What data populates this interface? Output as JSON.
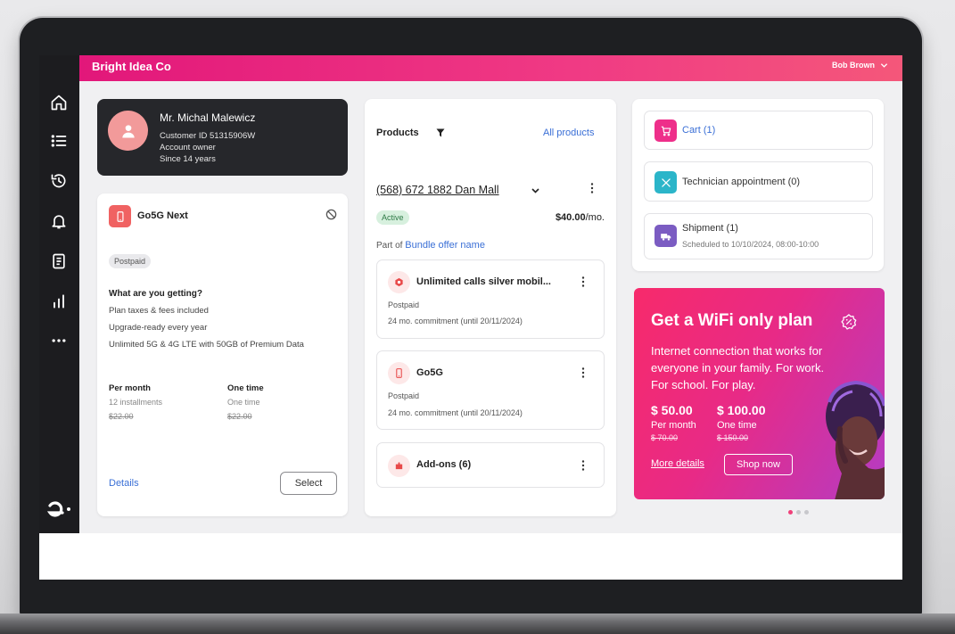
{
  "header": {
    "brand": "Bright Idea Co",
    "user": "Bob Brown",
    "user_menu_icon": "chevron-down-icon"
  },
  "sidebar": {
    "icons": [
      "home-icon",
      "list-icon",
      "history-icon",
      "bell-icon",
      "document-icon",
      "bar-chart-icon",
      "more-icon"
    ],
    "logo": "brand-logo"
  },
  "profile": {
    "name": "Mr. Michal Malewicz",
    "customer_id": "Customer ID 51315906W",
    "role": "Account owner",
    "since": "Since 14 years"
  },
  "plan": {
    "title": "Go5G Next",
    "type": "Postpaid",
    "getting_title": "What are you getting?",
    "features": [
      "Plan taxes & fees included",
      "Upgrade-ready every year",
      "Unlimited 5G & 4G LTE with 50GB of Premium Data"
    ],
    "per_month_label": "Per month",
    "per_month_sub": "12 installments",
    "per_month_price": "$22.00",
    "one_time_label": "One time",
    "one_time_sub": "One time",
    "one_time_price": "$22.00",
    "details_link": "Details",
    "select_button": "Select"
  },
  "products": {
    "title": "Products",
    "all_link": "All products",
    "line_name": "(568) 672 1882 Dan Mall",
    "status": "Active",
    "price": "$40.00",
    "price_unit": "/mo.",
    "part_of_label": "Part of",
    "bundle_link": "Bundle offer name",
    "items": [
      {
        "title": "Unlimited calls silver mobil...",
        "type": "Postpaid",
        "commitment": "24 mo. commitment (until 20/11/2024)"
      },
      {
        "title": "Go5G",
        "type": "Postpaid",
        "commitment": "24 mo. commitment (until 20/11/2024)"
      },
      {
        "title": "Add-ons (6)"
      }
    ]
  },
  "summary": {
    "cart": "Cart (1)",
    "technician": "Technician appointment (0)",
    "shipment": "Shipment (1)",
    "shipment_sub": "Scheduled to 10/10/2024, 08:00-10:00",
    "colors": {
      "cart": "#ee2f8a",
      "technician": "#2bb5c9",
      "shipment": "#7b5cc2"
    }
  },
  "promo": {
    "title": "Get a WiFi only plan",
    "text_lines": [
      "Internet connection that works for",
      "everyone in your family. For work.",
      "For school. For play."
    ],
    "price1": "$ 50.00",
    "label1": "Per month",
    "old1": "$ 70.00",
    "price2": "$ 100.00",
    "label2": "One time",
    "old2": "$ 150.00",
    "more_link": "More details",
    "shop_button": "Shop now"
  },
  "carousel": {
    "total": 3,
    "active": 1
  }
}
